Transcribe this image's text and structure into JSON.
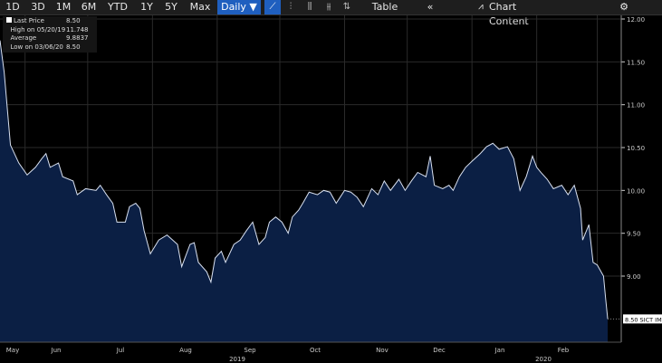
{
  "toolbar": {
    "periods": [
      "1D",
      "3D",
      "1M",
      "6M",
      "YTD",
      "1Y",
      "5Y",
      "Max"
    ],
    "frequency": "Daily ▼",
    "table": "Table",
    "collapse": "«",
    "chart_content": "Chart Content",
    "icons": [
      "line-chart-icon",
      "bar-chart-icon",
      "candlestick-icon",
      "ohlc-icon",
      "sort-icon",
      "chart-content-icon",
      "gear-icon"
    ],
    "accent": "#1f5fbf"
  },
  "legend": {
    "rows": [
      {
        "label": "Last Price",
        "value": "8.50"
      },
      {
        "label": "High on 05/20/19",
        "value": "11.748"
      },
      {
        "label": "Average",
        "value": "9.8837"
      },
      {
        "label": "Low on 03/06/20",
        "value": "8.50"
      }
    ]
  },
  "chart_data": {
    "type": "area",
    "ylim": [
      8.25,
      12.05
    ],
    "yticks": [
      "12.00",
      "11.50",
      "11.00",
      "10.50",
      "10.00",
      "9.50",
      "9.00"
    ],
    "last_price_tag": "8.50 SICT IM",
    "xticks": [
      "May",
      "Jun",
      "Jul",
      "Aug",
      "Sep",
      "Oct",
      "Nov",
      "Dec",
      "Jan",
      "Feb"
    ],
    "years": [
      "2019",
      "2020"
    ],
    "grid": true,
    "line_color": "#d8e0f0",
    "fill_color": "#0b1f44",
    "series": [
      [
        "2019-05-20",
        11.75
      ],
      [
        "2019-05-22",
        11.38
      ],
      [
        "2019-05-25",
        10.53
      ],
      [
        "2019-05-29",
        10.32
      ],
      [
        "2019-06-02",
        10.18
      ],
      [
        "2019-06-06",
        10.27
      ],
      [
        "2019-06-09",
        10.37
      ],
      [
        "2019-06-11",
        10.43
      ],
      [
        "2019-06-13",
        10.27
      ],
      [
        "2019-06-17",
        10.32
      ],
      [
        "2019-06-19",
        10.16
      ],
      [
        "2019-06-24",
        10.11
      ],
      [
        "2019-06-26",
        9.95
      ],
      [
        "2019-06-30",
        10.02
      ],
      [
        "2019-07-05",
        10.0
      ],
      [
        "2019-07-07",
        10.06
      ],
      [
        "2019-07-10",
        9.95
      ],
      [
        "2019-07-13",
        9.85
      ],
      [
        "2019-07-15",
        9.63
      ],
      [
        "2019-07-19",
        9.63
      ],
      [
        "2019-07-21",
        9.81
      ],
      [
        "2019-07-24",
        9.85
      ],
      [
        "2019-07-26",
        9.79
      ],
      [
        "2019-07-28",
        9.53
      ],
      [
        "2019-07-31",
        9.26
      ],
      [
        "2019-08-04",
        9.42
      ],
      [
        "2019-08-08",
        9.48
      ],
      [
        "2019-08-13",
        9.37
      ],
      [
        "2019-08-15",
        9.11
      ],
      [
        "2019-08-19",
        9.37
      ],
      [
        "2019-08-21",
        9.39
      ],
      [
        "2019-08-23",
        9.16
      ],
      [
        "2019-08-27",
        9.05
      ],
      [
        "2019-08-29",
        8.93
      ],
      [
        "2019-08-31",
        9.21
      ],
      [
        "2019-09-03",
        9.29
      ],
      [
        "2019-09-05",
        9.16
      ],
      [
        "2019-09-09",
        9.37
      ],
      [
        "2019-09-12",
        9.42
      ],
      [
        "2019-09-15",
        9.53
      ],
      [
        "2019-09-18",
        9.63
      ],
      [
        "2019-09-21",
        9.37
      ],
      [
        "2019-09-24",
        9.45
      ],
      [
        "2019-09-26",
        9.63
      ],
      [
        "2019-09-29",
        9.69
      ],
      [
        "2019-10-02",
        9.63
      ],
      [
        "2019-10-05",
        9.5
      ],
      [
        "2019-10-07",
        9.69
      ],
      [
        "2019-10-10",
        9.77
      ],
      [
        "2019-10-12",
        9.85
      ],
      [
        "2019-10-15",
        9.98
      ],
      [
        "2019-10-19",
        9.95
      ],
      [
        "2019-10-22",
        10.0
      ],
      [
        "2019-10-25",
        9.98
      ],
      [
        "2019-10-28",
        9.85
      ],
      [
        "2019-11-01",
        10.0
      ],
      [
        "2019-11-04",
        9.98
      ],
      [
        "2019-11-07",
        9.92
      ],
      [
        "2019-11-10",
        9.81
      ],
      [
        "2019-11-14",
        10.02
      ],
      [
        "2019-11-17",
        9.95
      ],
      [
        "2019-11-20",
        10.11
      ],
      [
        "2019-11-23",
        10.0
      ],
      [
        "2019-11-27",
        10.13
      ],
      [
        "2019-11-30",
        10.0
      ],
      [
        "2019-12-03",
        10.11
      ],
      [
        "2019-12-06",
        10.21
      ],
      [
        "2019-12-10",
        10.16
      ],
      [
        "2019-12-12",
        10.4
      ],
      [
        "2019-12-14",
        10.06
      ],
      [
        "2019-12-18",
        10.02
      ],
      [
        "2019-12-21",
        10.06
      ],
      [
        "2019-12-23",
        10.0
      ],
      [
        "2019-12-26",
        10.16
      ],
      [
        "2019-12-29",
        10.27
      ],
      [
        "2020-01-01",
        10.34
      ],
      [
        "2020-01-05",
        10.43
      ],
      [
        "2020-01-08",
        10.51
      ],
      [
        "2020-01-11",
        10.55
      ],
      [
        "2020-01-14",
        10.48
      ],
      [
        "2020-01-18",
        10.51
      ],
      [
        "2020-01-21",
        10.37
      ],
      [
        "2020-01-24",
        10.0
      ],
      [
        "2020-01-27",
        10.16
      ],
      [
        "2020-01-30",
        10.4
      ],
      [
        "2020-02-01",
        10.27
      ],
      [
        "2020-02-03",
        10.21
      ],
      [
        "2020-02-06",
        10.13
      ],
      [
        "2020-02-09",
        10.02
      ],
      [
        "2020-02-13",
        10.06
      ],
      [
        "2020-02-16",
        9.95
      ],
      [
        "2020-02-19",
        10.06
      ],
      [
        "2020-02-22",
        9.79
      ],
      [
        "2020-02-23",
        9.42
      ],
      [
        "2020-02-26",
        9.6
      ],
      [
        "2020-02-28",
        9.16
      ],
      [
        "2020-03-01",
        9.13
      ],
      [
        "2020-03-04",
        9.0
      ],
      [
        "2020-03-05",
        8.74
      ],
      [
        "2020-03-06",
        8.5
      ]
    ]
  }
}
